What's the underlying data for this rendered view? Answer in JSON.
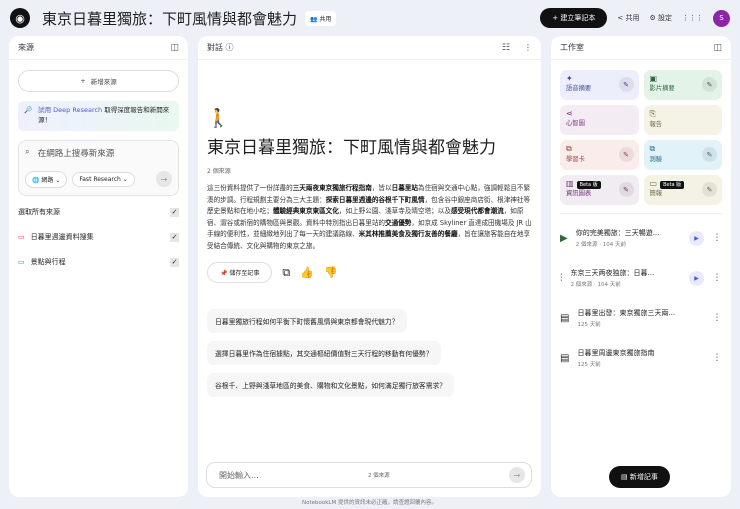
{
  "header": {
    "title": "東京日暮里獨旅：下町風情與都會魅力",
    "share_chip": "共用",
    "new_notebook": "建立筆記本",
    "share": "共用",
    "settings": "設定",
    "avatar": "S"
  },
  "sources": {
    "title": "來源",
    "add": "新增來源",
    "deep_link": "試用 Deep Research",
    "deep_rest": " 取得深度報告和新開來源！",
    "search_placeholder": "在網路上搜尋新來源",
    "web": "網路",
    "fast": "Fast Research",
    "select_all": "選取所有來源",
    "items": [
      {
        "label": "日暮里週邊資料搜集",
        "color": "#e53935"
      },
      {
        "label": "景點與行程",
        "color": "#1e88e5"
      }
    ]
  },
  "chat": {
    "title": "對話",
    "emoji": "🚶",
    "notebook_title": "東京日暮里獨旅：下町風情與都會魅力",
    "source_count": "2 個來源",
    "summary": [
      {
        "t": "這三份資料提供了一份詳盡的"
      },
      {
        "t": "三天兩夜東京獨旅行程指南",
        "b": true
      },
      {
        "t": "，皆以"
      },
      {
        "t": "日暮里站",
        "b": true
      },
      {
        "t": "為住宿與交通中心點，強調輕鬆且不緊湊的步調。行程規劃主要分為三大主題："
      },
      {
        "t": "探索日暮里週邊的谷根千下町風情",
        "b": true
      },
      {
        "t": "，包含谷中銀座商店街、根津神社等歷史景點和在地小吃；"
      },
      {
        "t": "體驗經典東京東區文化",
        "b": true
      },
      {
        "t": "，如上野公園、淺草寺及晴空塔；以及"
      },
      {
        "t": "感受現代都會潮流",
        "b": true
      },
      {
        "t": "，如原宿、澀谷或新宿的購物區與景觀。資料中特別指出日暮里站的"
      },
      {
        "t": "交通優勢",
        "b": true
      },
      {
        "t": "，如京成 Skyliner 直達成田機場及 JR 山手線的便利性，並細緻地列出了每一天的建議路線、"
      },
      {
        "t": "米其林推薦美食及獨行友善的餐廳",
        "b": true
      },
      {
        "t": "，旨在讓旅客能自在地享受結合傳統、文化與購物的東京之旅。"
      }
    ],
    "save_note": "儲存至記事",
    "suggestions": [
      "日暮里獨旅行程如何平衡下町懷舊風情與東京都會現代魅力？",
      "選擇日暮里作為住宿據點，其交通樞紐價值對三天行程的移動有何優勢？",
      "谷根千、上野與淺草地區的美食、購物和文化景點，如何滿足獨行旅客需求？"
    ],
    "input_placeholder": "開始輸入...",
    "input_count": "2 個來源",
    "footer": "NotebookLM 提供的資訊未必正確，請查證回覆內容。"
  },
  "studio": {
    "title": "工作室",
    "tiles": [
      {
        "label": "語音摘要",
        "bg": "#eceefb",
        "fg": "#3f4a9a",
        "icon": "✦",
        "edit": true
      },
      {
        "label": "影片摘要",
        "bg": "#e3f3e8",
        "fg": "#2e6b3e",
        "icon": "▣",
        "edit": true
      },
      {
        "label": "心智圖",
        "bg": "#f3ecf3",
        "fg": "#7b2d82",
        "icon": "⋖",
        "edit": false
      },
      {
        "label": "報告",
        "bg": "#f5f3e6",
        "fg": "#6b6440",
        "icon": "⎘",
        "edit": false
      },
      {
        "label": "學習卡",
        "bg": "#fbecec",
        "fg": "#9a3b3b",
        "icon": "⧉",
        "edit": true
      },
      {
        "label": "測驗",
        "bg": "#e1f2f8",
        "fg": "#2f6f8a",
        "icon": "⧉",
        "edit": true
      },
      {
        "label": "資訊圖表",
        "bg": "#f1ebf2",
        "fg": "#6b2f72",
        "icon": "▥",
        "edit": true,
        "beta": "Beta 版"
      },
      {
        "label": "簡報",
        "bg": "#f3f2e5",
        "fg": "#6b6440",
        "icon": "▭",
        "edit": true,
        "beta": "Beta 版"
      }
    ],
    "notes": [
      {
        "title": "你的完美獨旅：三天暢遊...",
        "meta": "2 個來源 · 104 天前",
        "icon": "▶",
        "play": true
      },
      {
        "title": "东京三天两夜独旅：日暮...",
        "meta": "2 個來源 · 104 天前",
        "icon": "⫶",
        "play": true
      },
      {
        "title": "日暮里出發：東京獨旅三天兩...",
        "meta": "125 天前",
        "icon": "▤",
        "play": false
      },
      {
        "title": "日暮里周邊東京獨旅指南",
        "meta": "125 天前",
        "icon": "▤",
        "play": false
      }
    ],
    "add_note": "新增記事"
  }
}
